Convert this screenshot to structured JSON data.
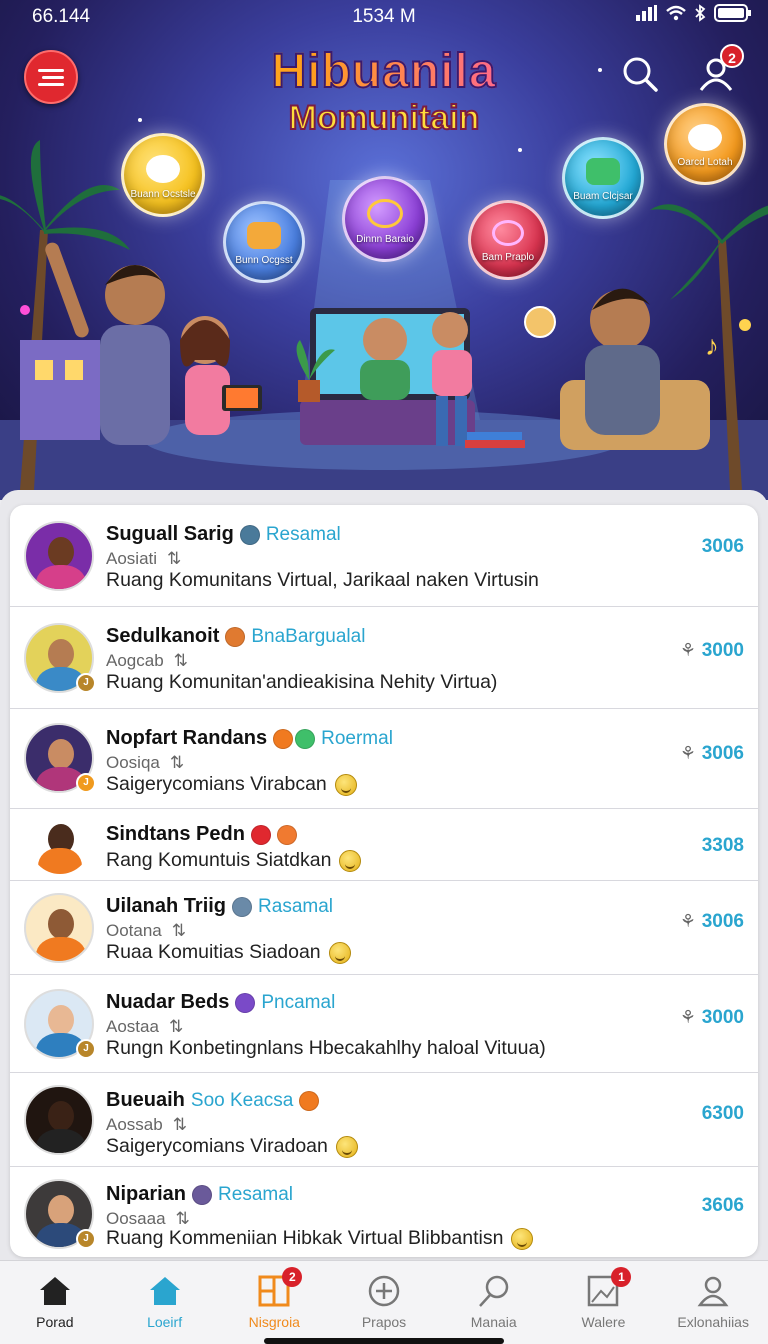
{
  "status_bar": {
    "time_left": "66.144",
    "time_center": "1534 M"
  },
  "header": {
    "logo_line1": "Hibuanila",
    "logo_line2": "Momunitain",
    "notification_count": "2"
  },
  "features": [
    {
      "label": "Buann Ocstsle",
      "color": "#f6c21f",
      "icon": "cat-icon"
    },
    {
      "label": "Bunn Ocgsst",
      "color": "#4a7fe0",
      "icon": "cube-icon"
    },
    {
      "label": "Dinnn Baraio",
      "color": "#8b3fd6",
      "icon": "music-note-icon"
    },
    {
      "label": "Bam Praplo",
      "color": "#d9334f",
      "icon": "flower-icon"
    },
    {
      "label": "Buam Clcjsar",
      "color": "#23a9d6",
      "icon": "chart-icon"
    },
    {
      "label": "Oarcd Lotah",
      "color": "#f49a1e",
      "icon": "mascot-icon"
    }
  ],
  "rows": [
    {
      "name": "Suguall Sarig",
      "tag": "Resamal",
      "sub": "Aosiati",
      "desc": "Ruang Komunitans Virtual, Jarikaal naken Virtusin",
      "count": "3006",
      "emoji": false,
      "dance": false,
      "skin": "#6b3b22",
      "shirt": "#d63f8a",
      "bg": "#7a2da8"
    },
    {
      "name": "Sedulkanoit",
      "tag": "BnaBargualal",
      "sub": "Aogcab",
      "desc": "Ruang Komunitan'andieakisina Nehity Virtua)",
      "count": "3000",
      "emoji": false,
      "dance": true,
      "skin": "#b57c52",
      "shirt": "#3a8ac7",
      "bg": "#e3d25a"
    },
    {
      "name": "Nopfart Randans",
      "tag": "Roermal",
      "sub": "Oosiqa",
      "desc": "Saigerycomians Virabcan",
      "count": "3006",
      "emoji": true,
      "dance": true,
      "skin": "#c98c63",
      "shirt": "#b0367a",
      "bg": "#3b2d6b"
    },
    {
      "name": "Sindtans Pedn",
      "tag": "",
      "sub": "",
      "desc": "Rang Komuntuis Siatdkan",
      "count": "3308",
      "emoji": true,
      "dance": false,
      "skin": "#4a2c1d",
      "shirt": "#f07a20",
      "bg": "#ffffff"
    },
    {
      "name": "Uilanah Triig",
      "tag": "Rasamal",
      "sub": "Ootana",
      "desc": "Ruaa Komuitias Siadoan",
      "count": "3006",
      "emoji": true,
      "dance": true,
      "skin": "#8e5a36",
      "shirt": "#f07a20",
      "bg": "#fbe9c4"
    },
    {
      "name": "Nuadar Beds",
      "tag": "Pncamal",
      "sub": "Aostaa",
      "desc": "Rungn Konbetingnlans Hbecakahlhy haloal Vituua)",
      "count": "3000",
      "emoji": false,
      "dance": true,
      "skin": "#e8b894",
      "shirt": "#2e7fbf",
      "bg": "#dbe8f4"
    },
    {
      "name": "Bueuaih",
      "tag": "Soo Keacsa",
      "sub": "Aossab",
      "desc": "Saigerycomians Viradoan",
      "count": "6300",
      "emoji": true,
      "dance": false,
      "skin": "#3a2216",
      "shirt": "#222222",
      "bg": "#201510"
    },
    {
      "name": "Niparian",
      "tag": "Resamal",
      "sub": "Oosaaa",
      "desc": "Ruang Kommeniian Hibkak Virtual Blibbantisn",
      "count": "3606",
      "emoji": true,
      "dance": false,
      "skin": "#d8a27a",
      "shirt": "#2c4a7a",
      "bg": "#3d3a3a"
    }
  ],
  "nav": [
    {
      "label": "Porad",
      "icon": "home-filled-icon",
      "color": "#222222",
      "badge": ""
    },
    {
      "label": "Loeirf",
      "icon": "home-icon",
      "color": "#2aa5cf",
      "badge": ""
    },
    {
      "label": "Nisgroia",
      "icon": "grid-icon",
      "color": "#f08a1c",
      "badge": "2"
    },
    {
      "label": "Prapos",
      "icon": "plus-circle-icon",
      "color": "#777777",
      "badge": ""
    },
    {
      "label": "Manaia",
      "icon": "magnifier-icon",
      "color": "#777777",
      "badge": ""
    },
    {
      "label": "Walere",
      "icon": "image-icon",
      "color": "#777777",
      "badge": "1"
    },
    {
      "label": "Exlonahiias",
      "icon": "profile-icon",
      "color": "#777777",
      "badge": ""
    }
  ],
  "colors": {
    "accent": "#2aa5cf",
    "badge_red": "#d8212a",
    "menu_red": "#e0282f"
  }
}
